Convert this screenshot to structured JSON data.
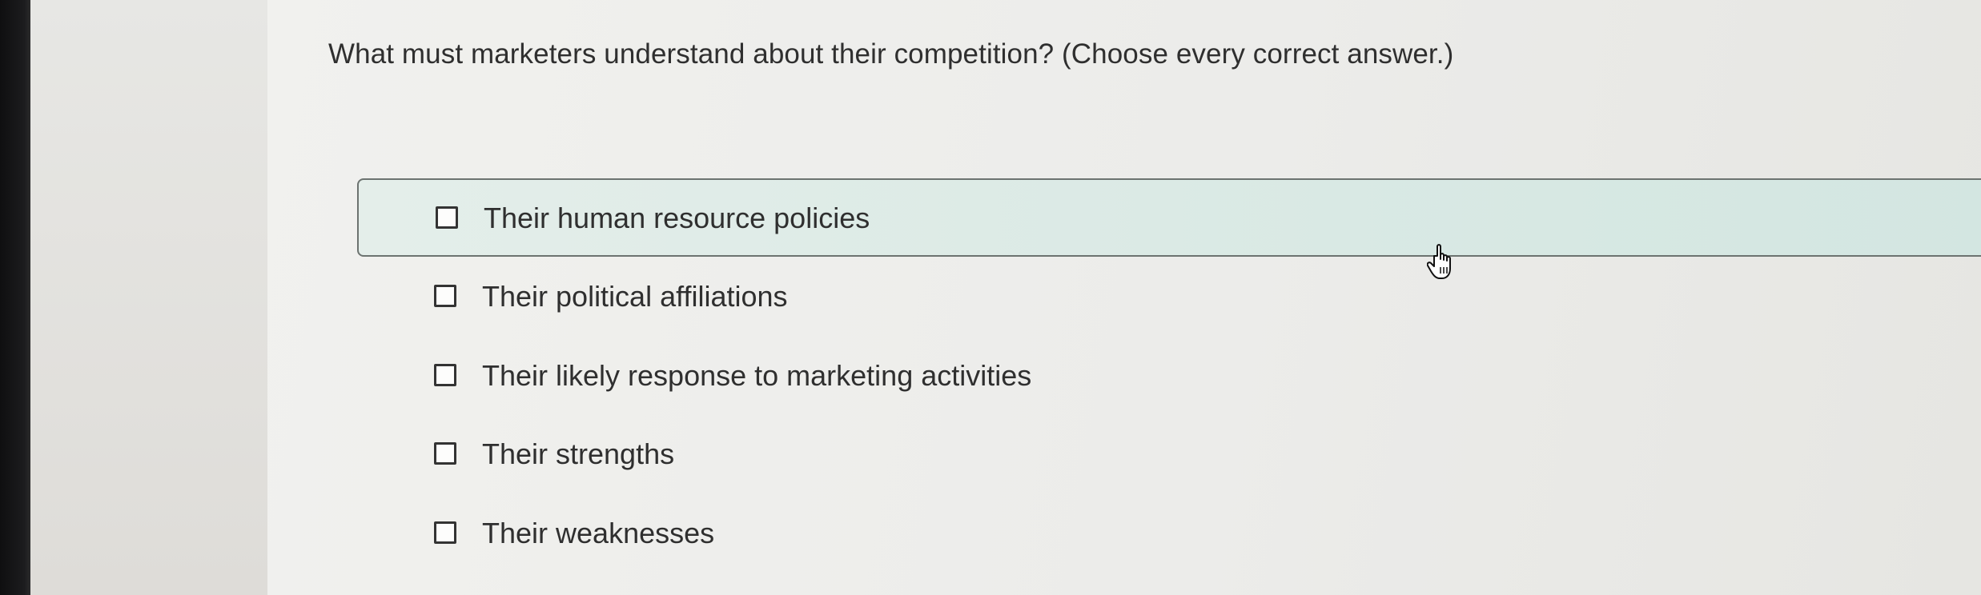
{
  "question": {
    "text": "What must marketers understand about their competition? (Choose every correct answer.)"
  },
  "options": [
    {
      "label": "Their human resource policies",
      "checked": false,
      "highlighted": true
    },
    {
      "label": "Their political affiliations",
      "checked": false,
      "highlighted": false
    },
    {
      "label": "Their likely response to marketing activities",
      "checked": false,
      "highlighted": false
    },
    {
      "label": "Their strengths",
      "checked": false,
      "highlighted": false
    },
    {
      "label": "Their weaknesses",
      "checked": false,
      "highlighted": false
    }
  ],
  "cursor": {
    "icon": "hand-pointer-icon"
  },
  "colors": {
    "text": "#2f2f2f",
    "highlight_bg": "#d9e9e4",
    "highlight_border": "#6c7370"
  }
}
